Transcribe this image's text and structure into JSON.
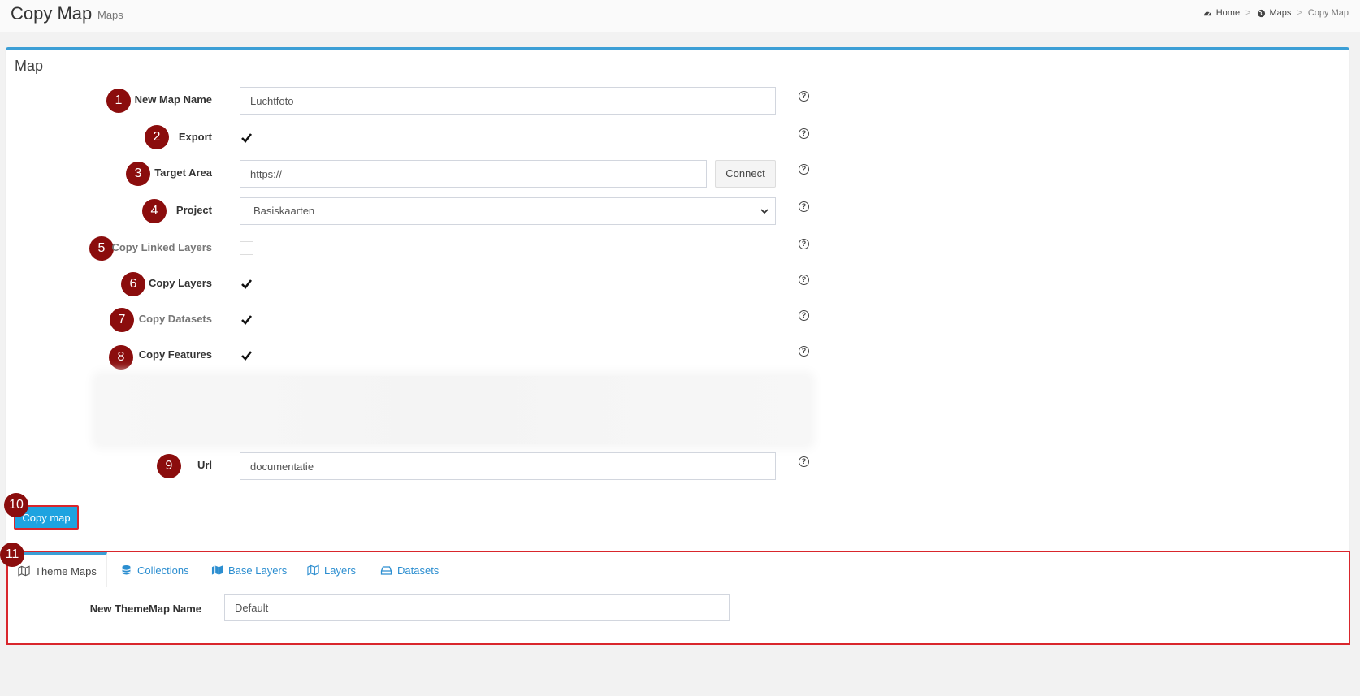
{
  "header": {
    "title": "Copy Map",
    "subtitle": "Maps",
    "breadcrumb": {
      "home": "Home",
      "maps": "Maps",
      "current": "Copy Map",
      "separator": ">"
    }
  },
  "box": {
    "title": "Map"
  },
  "form": {
    "new_map_name": {
      "badge": "1",
      "label": "New Map Name",
      "value": "Luchtfoto"
    },
    "export": {
      "badge": "2",
      "label": "Export",
      "checked": true
    },
    "target_area": {
      "badge": "3",
      "label": "Target Area",
      "value": "https://",
      "connect_label": "Connect"
    },
    "project": {
      "badge": "4",
      "label": "Project",
      "selected": "Basiskaarten"
    },
    "copy_linked_layers": {
      "badge": "5",
      "label": "Copy Linked Layers",
      "checked": false
    },
    "copy_layers": {
      "badge": "6",
      "label": "Copy Layers",
      "checked": true
    },
    "copy_datasets": {
      "badge": "7",
      "label": "Copy Datasets",
      "checked": true
    },
    "copy_features": {
      "badge": "8",
      "label": "Copy Features",
      "checked": true
    },
    "url": {
      "badge": "9",
      "label": "Url",
      "value": "documentatie"
    },
    "help_glyph": "?"
  },
  "footer": {
    "badge": "10",
    "copy_button": "Copy map"
  },
  "tabs": {
    "badge": "11",
    "items": [
      {
        "label": "Theme Maps",
        "icon": "map-icon",
        "active": true
      },
      {
        "label": "Collections",
        "icon": "database-icon",
        "active": false
      },
      {
        "label": "Base Layers",
        "icon": "map-filled-icon",
        "active": false
      },
      {
        "label": "Layers",
        "icon": "map-icon",
        "active": false
      },
      {
        "label": "Datasets",
        "icon": "drive-icon",
        "active": false
      }
    ],
    "theme_map_name_label": "New ThemeMap Name",
    "theme_map_name_value": "Default"
  },
  "colors": {
    "accent": "#3c9fd6",
    "button": "#1ea3e0",
    "badge": "#8b0d0d",
    "highlight": "#d9262c"
  }
}
